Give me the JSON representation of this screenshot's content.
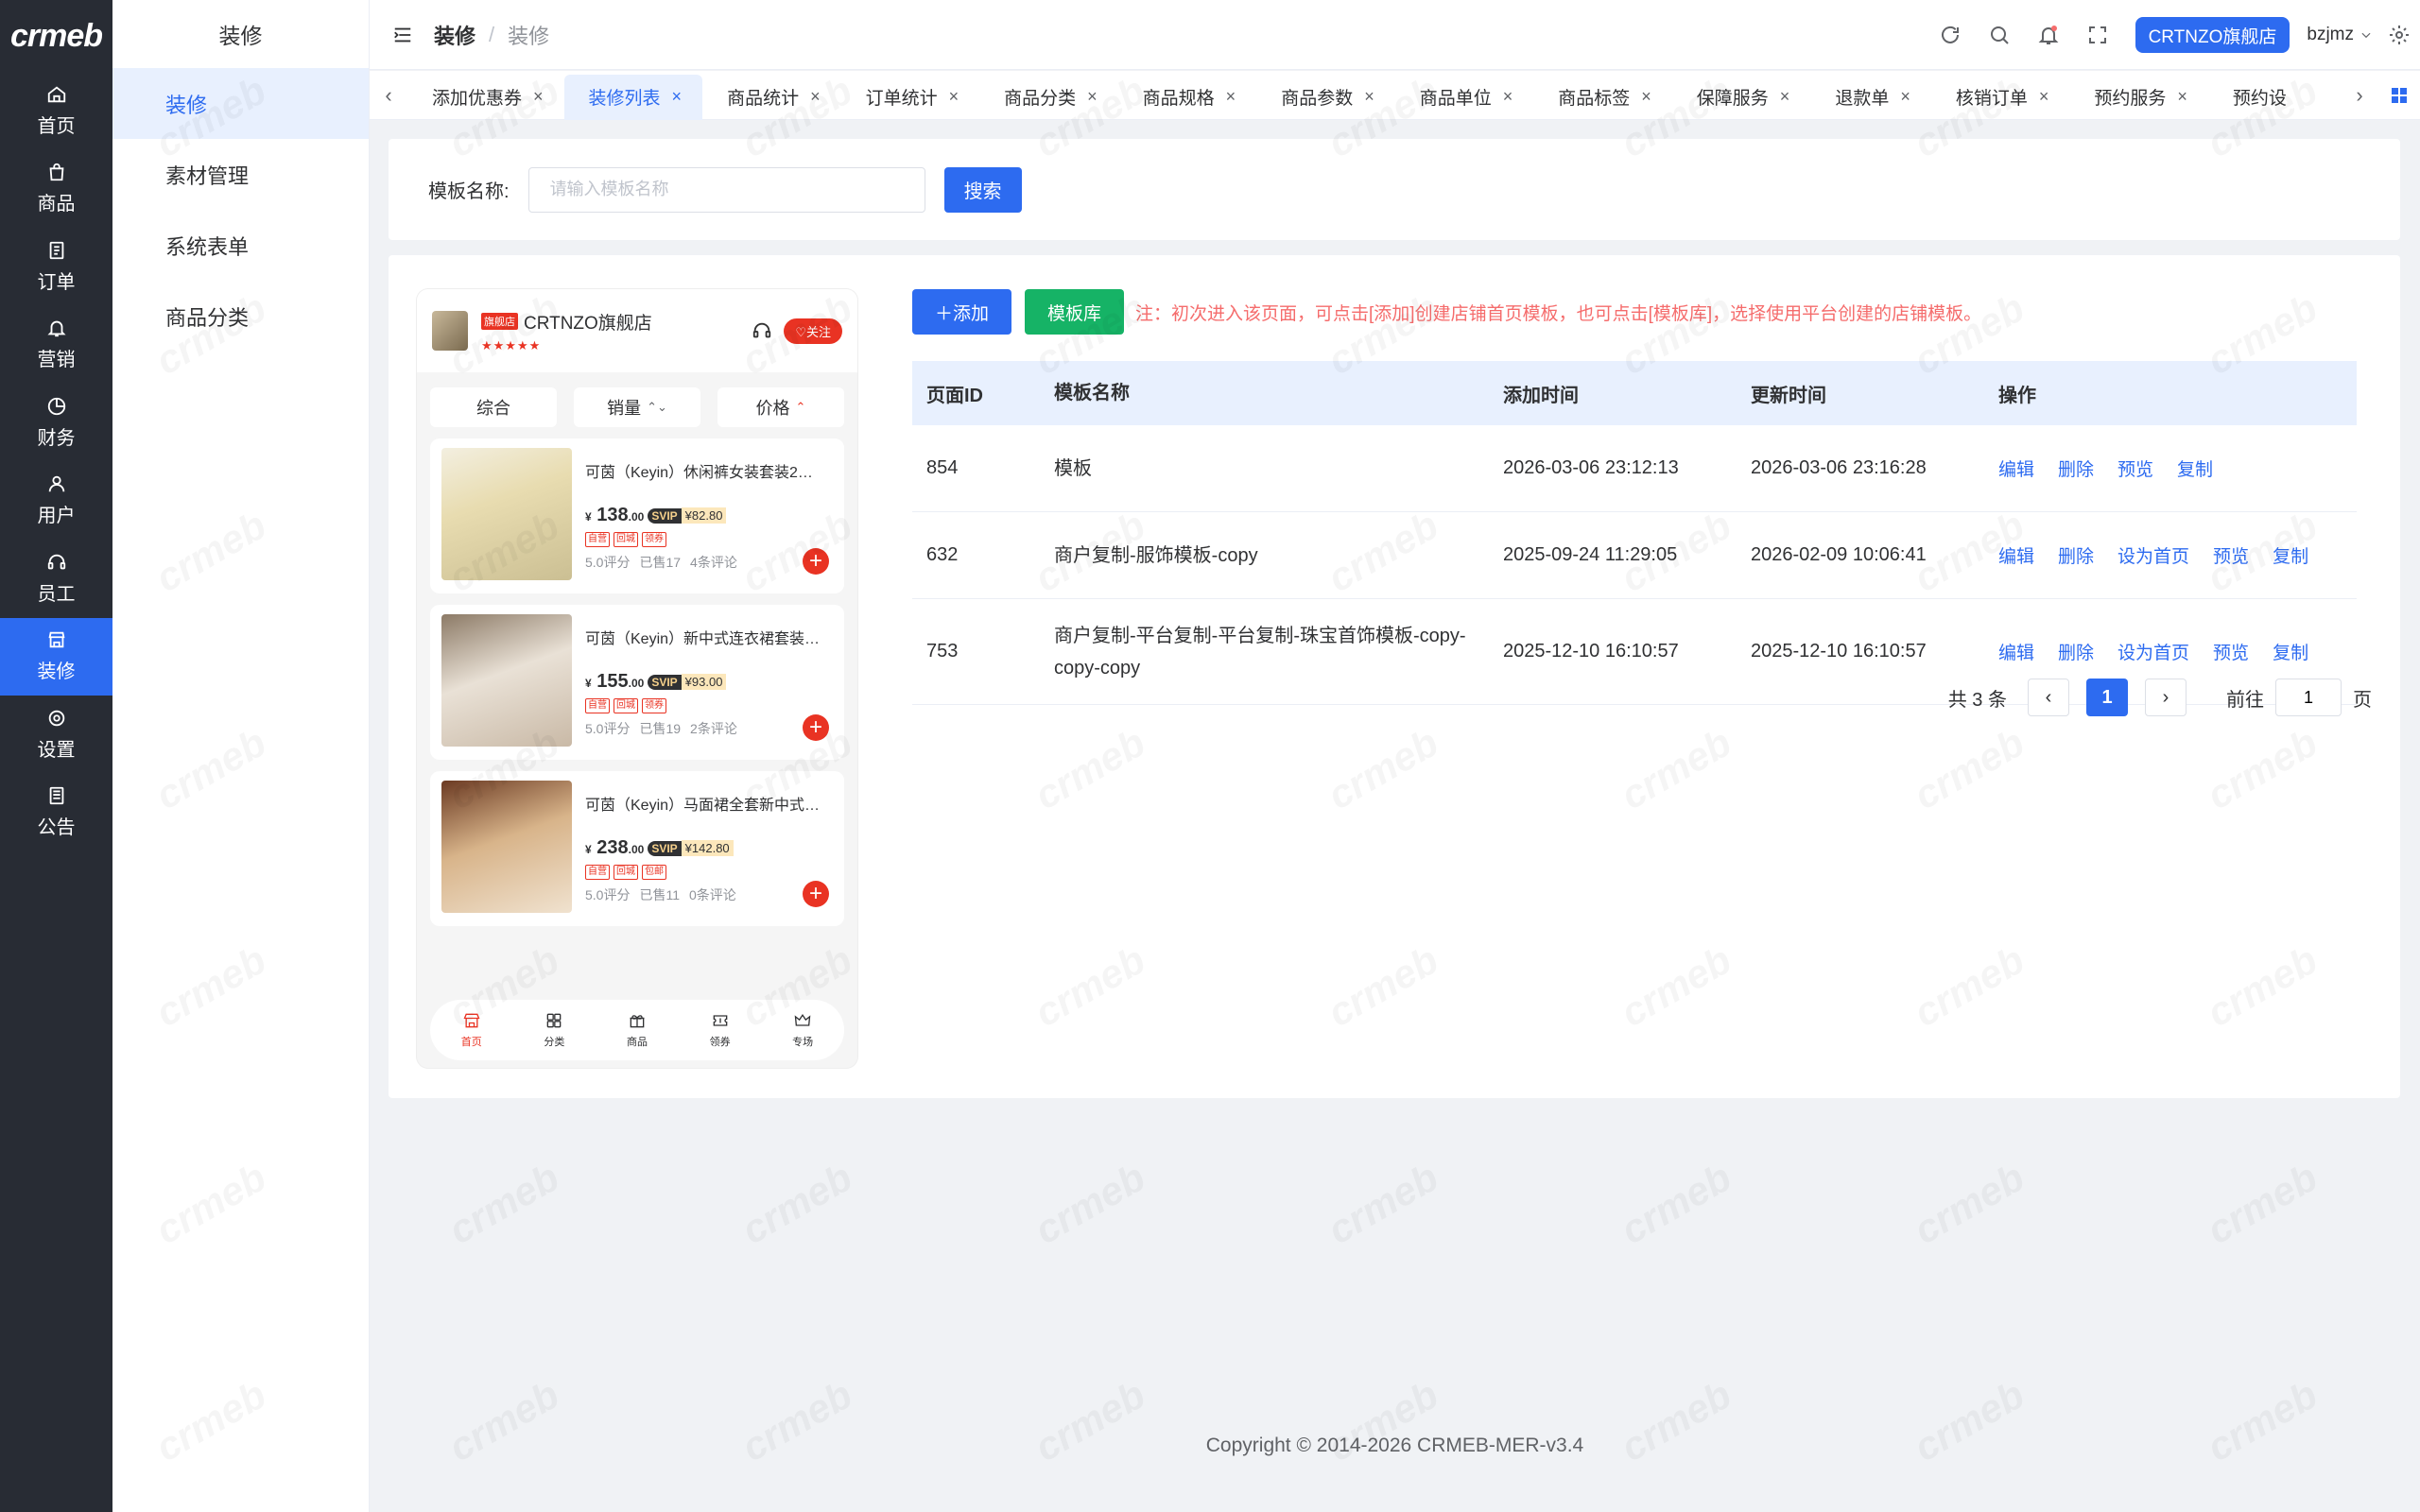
{
  "brand": {
    "logo_text": "crmeb"
  },
  "rail": [
    {
      "label": "首页",
      "icon": "home-icon",
      "active": false
    },
    {
      "label": "商品",
      "icon": "bag-icon",
      "active": false
    },
    {
      "label": "订单",
      "icon": "doc-icon",
      "active": false
    },
    {
      "label": "营销",
      "icon": "bell-icon",
      "active": false
    },
    {
      "label": "财务",
      "icon": "pie-icon",
      "active": false
    },
    {
      "label": "用户",
      "icon": "user-icon",
      "active": false
    },
    {
      "label": "员工",
      "icon": "headset-icon",
      "active": false
    },
    {
      "label": "装修",
      "icon": "shop-icon",
      "active": true
    },
    {
      "label": "设置",
      "icon": "gear-icon",
      "active": false
    },
    {
      "label": "公告",
      "icon": "notice-icon",
      "active": false
    }
  ],
  "submenu": {
    "title": "装修",
    "items": [
      "装修",
      "素材管理",
      "系统表单",
      "商品分类"
    ]
  },
  "header": {
    "breadcrumb_first": "装修",
    "breadcrumb_sep": "/",
    "breadcrumb_last": "装修",
    "store_button": "CRTNZO旗舰店",
    "username": "bzjmz"
  },
  "tabs": [
    {
      "label": "添加优惠券",
      "active": false
    },
    {
      "label": "装修列表",
      "active": true
    },
    {
      "label": "商品统计",
      "active": false
    },
    {
      "label": "订单统计",
      "active": false
    },
    {
      "label": "商品分类",
      "active": false
    },
    {
      "label": "商品规格",
      "active": false
    },
    {
      "label": "商品参数",
      "active": false
    },
    {
      "label": "商品单位",
      "active": false
    },
    {
      "label": "商品标签",
      "active": false
    },
    {
      "label": "保障服务",
      "active": false
    },
    {
      "label": "退款单",
      "active": false
    },
    {
      "label": "核销订单",
      "active": false
    },
    {
      "label": "预约服务",
      "active": false
    },
    {
      "label": "预约设",
      "active": false
    }
  ],
  "search": {
    "label": "模板名称:",
    "placeholder": "请输入模板名称",
    "button": "搜索"
  },
  "preview": {
    "flag": "旗舰店",
    "shop_name": "CRTNZO旗舰店",
    "stars": "★★★★★",
    "follow": "♡关注",
    "sort": {
      "all": "综合",
      "sales": "销量",
      "sales_sub": "⌃⌄",
      "price": "价格",
      "price_sub": "⌃"
    },
    "goods": [
      {
        "name": "可茵（Keyin）休闲裤女装套装2…",
        "price": "138",
        "price_dec": ".00",
        "svip": "SVIP",
        "svip_price": "¥82.80",
        "tags": [
          "自营",
          "回城",
          "领券"
        ],
        "score": "5.0评分",
        "sold": "已售17",
        "comments": "4条评论"
      },
      {
        "name": "可茵（Keyin）新中式连衣裙套装…",
        "price": "155",
        "price_dec": ".00",
        "svip": "SVIP",
        "svip_price": "¥93.00",
        "tags": [
          "自营",
          "回城",
          "领券"
        ],
        "score": "5.0评分",
        "sold": "已售19",
        "comments": "2条评论"
      },
      {
        "name": "可茵（Keyin）马面裙全套新中式…",
        "price": "238",
        "price_dec": ".00",
        "svip": "SVIP",
        "svip_price": "¥142.80",
        "tags": [
          "自营",
          "回城",
          "包邮"
        ],
        "score": "5.0评分",
        "sold": "已售11",
        "comments": "0条评论"
      }
    ],
    "currency": "¥",
    "nav": [
      {
        "label": "首页",
        "icon": "shop-front-icon",
        "active": true
      },
      {
        "label": "分类",
        "icon": "category-icon",
        "active": false
      },
      {
        "label": "商品",
        "icon": "gift-icon",
        "active": false
      },
      {
        "label": "领券",
        "icon": "coupon-icon",
        "active": false
      },
      {
        "label": "专场",
        "icon": "crown-icon",
        "active": false
      }
    ]
  },
  "toolbar": {
    "add": "＋添加",
    "library": "模板库",
    "tip": "注：初次进入该页面，可点击[添加]创建店铺首页模板，也可点击[模板库]，选择使用平台创建的店铺模板。"
  },
  "table": {
    "headers": [
      "页面ID",
      "模板名称",
      "添加时间",
      "更新时间",
      "操作"
    ],
    "rows": [
      {
        "id": "854",
        "name": "模板",
        "created": "2026-03-06 23:12:13",
        "updated": "2026-03-06 23:16:28",
        "actions": [
          "编辑",
          "删除",
          "预览",
          "复制"
        ]
      },
      {
        "id": "632",
        "name": "商户复制-服饰模板-copy",
        "created": "2025-09-24 11:29:05",
        "updated": "2026-02-09 10:06:41",
        "actions": [
          "编辑",
          "删除",
          "设为首页",
          "预览",
          "复制"
        ]
      },
      {
        "id": "753",
        "name": "商户复制-平台复制-平台复制-珠宝首饰模板-copy-copy-copy",
        "created": "2025-12-10 16:10:57",
        "updated": "2025-12-10 16:10:57",
        "actions": [
          "编辑",
          "删除",
          "设为首页",
          "预览",
          "复制"
        ]
      }
    ]
  },
  "pagination": {
    "total": "共 3 条",
    "current": "1",
    "goto_label": "前往",
    "goto_value": "1",
    "unit": "页"
  },
  "footer": {
    "copyright": "Copyright © 2014-2026 CRMEB-MER-v3.4"
  },
  "colors": {
    "primary": "#2d6bf0",
    "success": "#16b366",
    "danger": "#e93323",
    "rail_bg": "#282c34"
  }
}
